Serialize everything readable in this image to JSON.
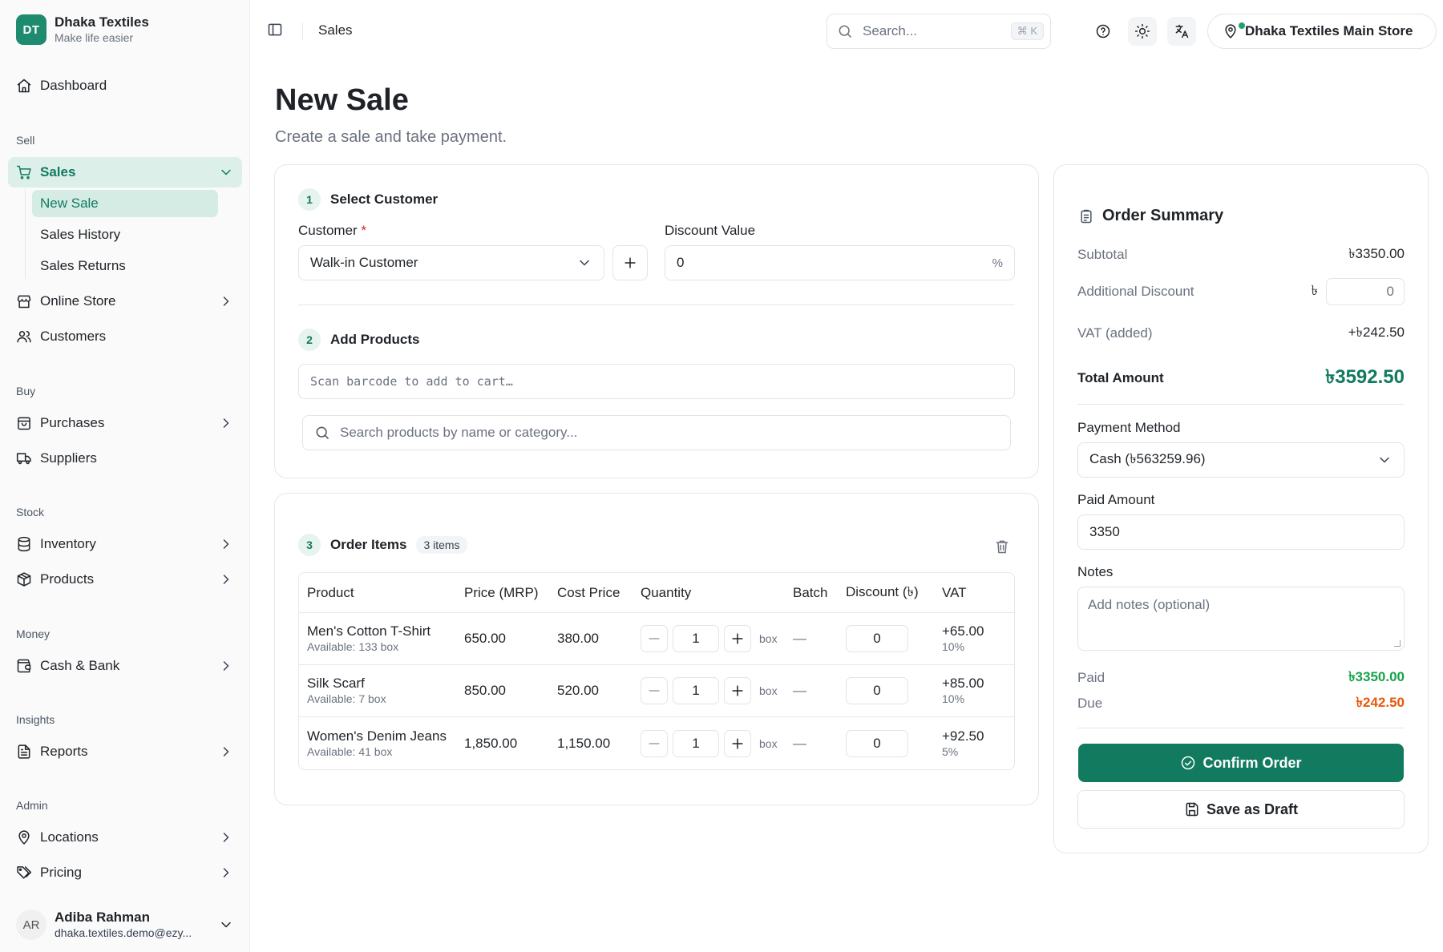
{
  "brand": {
    "initials": "DT",
    "name": "Dhaka Textiles",
    "tagline": "Make life easier"
  },
  "sidebar": {
    "dashboard": "Dashboard",
    "sections": {
      "sell": "Sell",
      "buy": "Buy",
      "stock": "Stock",
      "money": "Money",
      "insights": "Insights",
      "admin": "Admin"
    },
    "items": {
      "sales": "Sales",
      "new_sale": "New Sale",
      "sales_history": "Sales History",
      "sales_returns": "Sales Returns",
      "online_store": "Online Store",
      "customers": "Customers",
      "purchases": "Purchases",
      "suppliers": "Suppliers",
      "inventory": "Inventory",
      "products": "Products",
      "cash_bank": "Cash & Bank",
      "reports": "Reports",
      "locations": "Locations",
      "pricing": "Pricing"
    },
    "user": {
      "initials": "AR",
      "name": "Adiba Rahman",
      "email": "dhaka.textiles.demo@ezy..."
    }
  },
  "header": {
    "breadcrumb": "Sales",
    "search_placeholder": "Search...",
    "search_shortcut": "⌘ K",
    "store": "Dhaka Textiles Main Store"
  },
  "page": {
    "title": "New Sale",
    "subtitle": "Create a sale and take payment."
  },
  "customer_step": {
    "number": "1",
    "title": "Select Customer",
    "customer_label": "Customer",
    "required_mark": "*",
    "customer_value": "Walk-in Customer",
    "discount_label": "Discount Value",
    "discount_value": "0",
    "discount_suffix": "%"
  },
  "products_step": {
    "number": "2",
    "title": "Add Products",
    "barcode_placeholder": "Scan barcode to add to cart…",
    "search_placeholder": "Search products by name or category..."
  },
  "order_items": {
    "number": "3",
    "title": "Order Items",
    "count": "3 items",
    "columns": [
      "Product",
      "Price (MRP)",
      "Cost Price",
      "Quantity",
      "Batch",
      "Discount (৳)",
      "VAT"
    ],
    "rows": [
      {
        "name": "Men's Cotton T-Shirt",
        "available": "Available: 133 box",
        "price": "650.00",
        "cost": "380.00",
        "qty": "1",
        "unit": "box",
        "batch": "—",
        "discount": "0",
        "vat": "+65.00",
        "vat_rate": "10%"
      },
      {
        "name": "Silk Scarf",
        "available": "Available: 7 box",
        "price": "850.00",
        "cost": "520.00",
        "qty": "1",
        "unit": "box",
        "batch": "—",
        "discount": "0",
        "vat": "+85.00",
        "vat_rate": "10%"
      },
      {
        "name": "Women's Denim Jeans",
        "available": "Available: 41 box",
        "price": "1,850.00",
        "cost": "1,150.00",
        "qty": "1",
        "unit": "box",
        "batch": "—",
        "discount": "0",
        "vat": "+92.50",
        "vat_rate": "5%"
      }
    ]
  },
  "summary": {
    "title": "Order Summary",
    "subtotal_label": "Subtotal",
    "subtotal": "৳3350.00",
    "additional_discount_label": "Additional Discount",
    "currency_symbol": "৳",
    "additional_discount": "0",
    "vat_label": "VAT (added)",
    "vat": "+৳242.50",
    "total_label": "Total Amount",
    "total": "৳3592.50",
    "payment_method_label": "Payment Method",
    "payment_method": "Cash (৳563259.96)",
    "paid_amount_label": "Paid Amount",
    "paid_amount": "3350",
    "notes_label": "Notes",
    "notes_placeholder": "Add notes (optional)",
    "paid_label": "Paid",
    "paid": "৳3350.00",
    "due_label": "Due",
    "due": "৳242.50",
    "confirm_label": "Confirm Order",
    "draft_label": "Save as Draft"
  },
  "colors": {
    "accent": "#127a5f",
    "paid": "#16a34a",
    "due": "#ea580c",
    "required": "#dc2626"
  }
}
